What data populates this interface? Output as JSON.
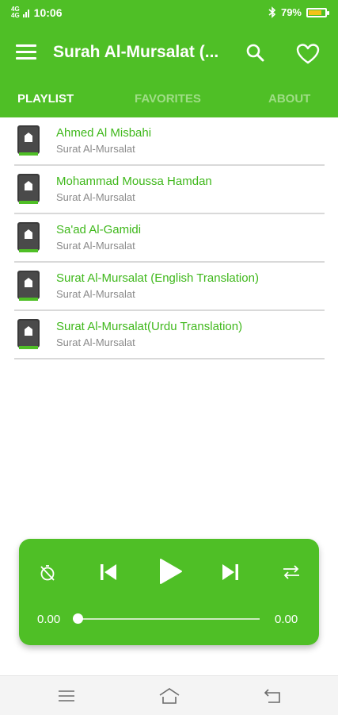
{
  "status": {
    "network_top": "4G",
    "network_bottom": "4G",
    "time": "10:06",
    "battery": "79%",
    "battery_level": 0.79
  },
  "appbar": {
    "title": "Surah Al-Mursalat (..."
  },
  "tabs": [
    {
      "label": "PLAYLIST",
      "active": true
    },
    {
      "label": "FAVORITES",
      "active": false
    },
    {
      "label": "ABOUT",
      "active": false
    }
  ],
  "playlist": [
    {
      "name": "Ahmed Al Misbahi",
      "subtitle": "Surat Al-Mursalat"
    },
    {
      "name": "Mohammad Moussa Hamdan",
      "subtitle": "Surat Al-Mursalat"
    },
    {
      "name": "Sa'ad Al-Gamidi",
      "subtitle": "Surat Al-Mursalat"
    },
    {
      "name": "Surat Al-Mursalat (English Translation)",
      "subtitle": "Surat Al-Mursalat"
    },
    {
      "name": "Surat Al-Mursalat(Urdu Translation)",
      "subtitle": "Surat Al-Mursalat"
    }
  ],
  "player": {
    "current_time": "0.00",
    "total_time": "0.00",
    "progress": 0
  },
  "colors": {
    "primary": "#4fbf26",
    "item_title": "#3fb81b",
    "subtitle": "#8a8a8a"
  },
  "icons": [
    "menu-icon",
    "search-icon",
    "heart-icon",
    "book-icon",
    "timer-off-icon",
    "skip-previous-icon",
    "play-icon",
    "skip-next-icon",
    "repeat-icon",
    "nav-menu-icon",
    "nav-home-icon",
    "nav-back-icon"
  ]
}
